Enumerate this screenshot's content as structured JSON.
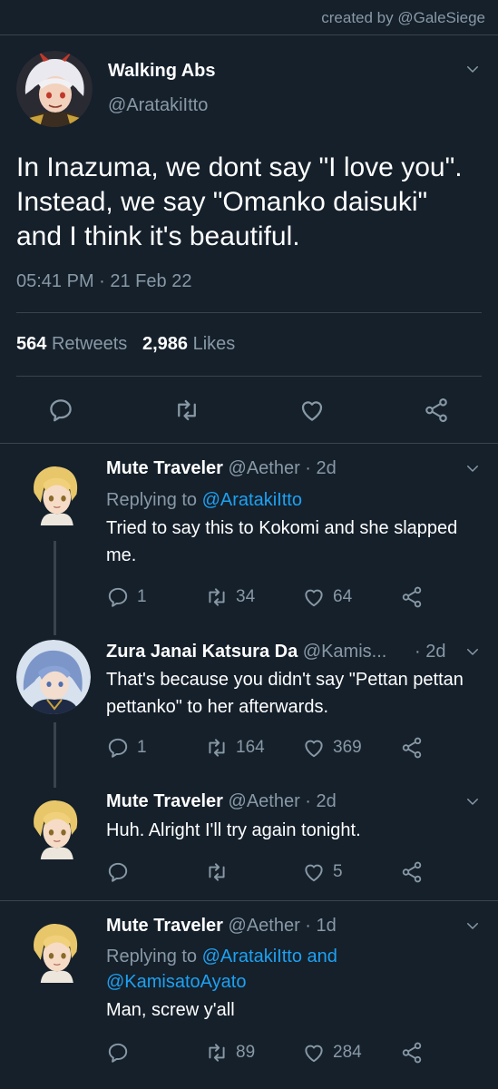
{
  "credit": "created by @GaleSiege",
  "colors": {
    "background": "#15202b",
    "text": "#ffffff",
    "muted": "#8899a6",
    "link": "#1da1f2",
    "divider": "#38444d"
  },
  "main_tweet": {
    "name": "Walking Abs",
    "handle": "@AratakiItto",
    "text": "In Inazuma, we dont say \"I love you\". Instead, we say \"Omanko daisuki\" and I think it's beautiful.",
    "date": "05:41 PM · 21 Feb 22",
    "retweets_count": "564",
    "retweets_label": "Retweets",
    "likes_count": "2,986",
    "likes_label": "Likes",
    "icons": [
      "reply-icon",
      "retweet-icon",
      "like-icon",
      "share-icon",
      "chevron-down-icon"
    ]
  },
  "replies": [
    {
      "name": "Mute Traveler",
      "handle": "@Aether · 2d",
      "replying_prefix": "Replying to ",
      "replying_to": "@AratakiItto",
      "text": "Tried to say this to Kokomi and she slapped me.",
      "reply_count": "1",
      "retweet_count": "34",
      "like_count": "64"
    },
    {
      "name": "Zura Janai Katsura Da",
      "handle": "@Kamis...",
      "time": "· 2d",
      "text": "That's because you didn't say \"Pettan pettan pettanko\" to her afterwards.",
      "reply_count": "1",
      "retweet_count": "164",
      "like_count": "369"
    },
    {
      "name": "Mute Traveler",
      "handle": "@Aether · 2d",
      "text": "Huh. Alright I'll try again tonight.",
      "reply_count": "",
      "retweet_count": "",
      "like_count": "5"
    },
    {
      "name": "Mute Traveler",
      "handle": "@Aether · 1d",
      "replying_prefix": "Replying to ",
      "replying_to": "@AratakiItto and @KamisatoAyato",
      "text": "Man, screw y'all",
      "reply_count": "",
      "retweet_count": "89",
      "like_count": "284"
    }
  ]
}
